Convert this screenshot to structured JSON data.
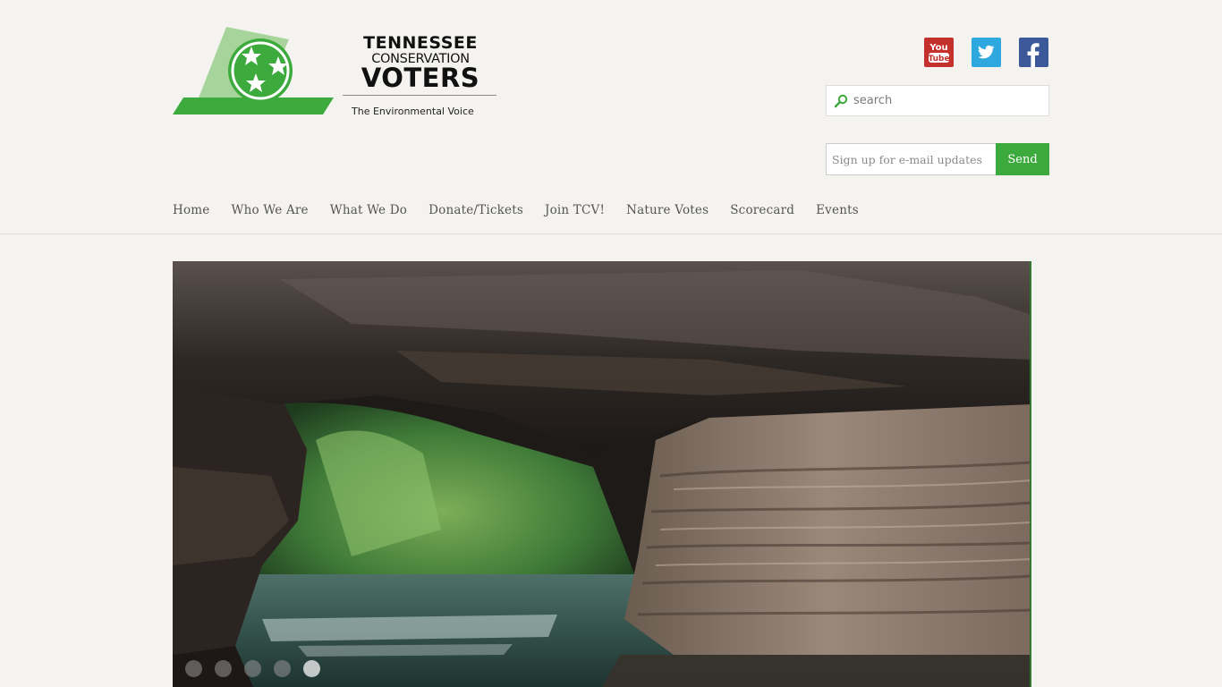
{
  "logo": {
    "line1": "TENNESSEE",
    "line2": "CONSERVATION",
    "line3": "VOTERS",
    "tagline": "The Environmental Voice",
    "brand_green": "#3daa3d"
  },
  "social": {
    "youtube": {
      "icon": "youtube-icon",
      "label": "You Tube",
      "color": "#c4302b"
    },
    "twitter": {
      "icon": "twitter-icon",
      "color": "#2fa8e0"
    },
    "facebook": {
      "icon": "facebook-icon",
      "color": "#3b5998"
    }
  },
  "search": {
    "placeholder": "search",
    "icon": "search-icon"
  },
  "email_signup": {
    "placeholder": "Sign up for e-mail updates",
    "button": "Send"
  },
  "nav": {
    "items": [
      "Home",
      "Who We Are",
      "What We Do",
      "Donate/Tickets",
      "Join TCV!",
      "Nature Votes",
      "Scorecard",
      "Events"
    ]
  },
  "slider": {
    "slide_count": 5,
    "active_slide": 5,
    "image_subject": "sandstone rock arch over a river with forest"
  }
}
